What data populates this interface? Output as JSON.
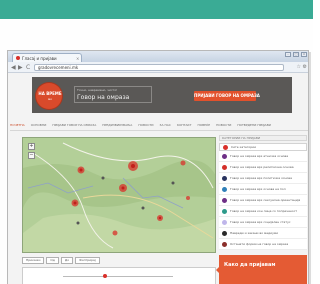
{
  "browser": {
    "tab_title": "Гласај и пријави",
    "tab_close": "×",
    "url": "gradovrecemeni.mk",
    "back_glyph": "◀",
    "forward_glyph": "▶",
    "reload_glyph": "C",
    "addr_icons": "☆ ⚙",
    "window_controls": [
      "–",
      "□",
      "×"
    ]
  },
  "site": {
    "logo_line1": "НА ВРЕМЕ",
    "logo_line2": "мк",
    "tagline_top": "Точно, навремено, чисто!",
    "tagline_main": "Говор на омраза",
    "report_button": "ПРИЈАВИ ГОВОР НА ОМРАЗА",
    "menu_items": [
      "ПОЧЕТНА",
      "ОСНОВНИ",
      "ПРИЈАВИ ГОВОР НА ОМРАЗА",
      "ПРЕДИЗВИКУВАЊА",
      "НОВОСТИ",
      "ЗА НАС",
      "КОНТАКТ",
      "ПОВЕЌЕ",
      "НОВОСТИ",
      "ПОТВРДЕНИ ПРИЈАВИ"
    ]
  },
  "map": {
    "zoom_in": "+",
    "zoom_out": "−",
    "accent_color": "#d9302a"
  },
  "legend": {
    "header": "КАТЕГОРИИ НА ПРИЈАВИ",
    "top_item": "Сите категории",
    "items": [
      {
        "label": "Говор на омраза врз етничка основа",
        "color": "#6e2f86"
      },
      {
        "label": "Говор на омраза врз религиозна основа",
        "color": "#d4302a"
      },
      {
        "label": "Говор на омраза врз политичка основа",
        "color": "#29335f"
      },
      {
        "label": "Говор на омраза врз основа на пол",
        "color": "#2f7fb8"
      },
      {
        "label": "Говор на омраза врз сексуална ориентација",
        "color": "#6e2f86"
      },
      {
        "label": "Говор на омраза кон лица со попреченост",
        "color": "#2d9a8b"
      },
      {
        "label": "Говор на омраза врз социјален статус",
        "color": "#bfb6ea"
      },
      {
        "label": "Навреди и закани во медиуми",
        "color": "#2a2a2a"
      },
      {
        "label": "Останати форми на говор на омраза",
        "color": "#8b2f2b"
      }
    ]
  },
  "controls": {
    "filter_buttons": [
      "Прикажи",
      "Од",
      "До",
      "Филтрирај"
    ],
    "howto_title": "Како да пријавам"
  }
}
